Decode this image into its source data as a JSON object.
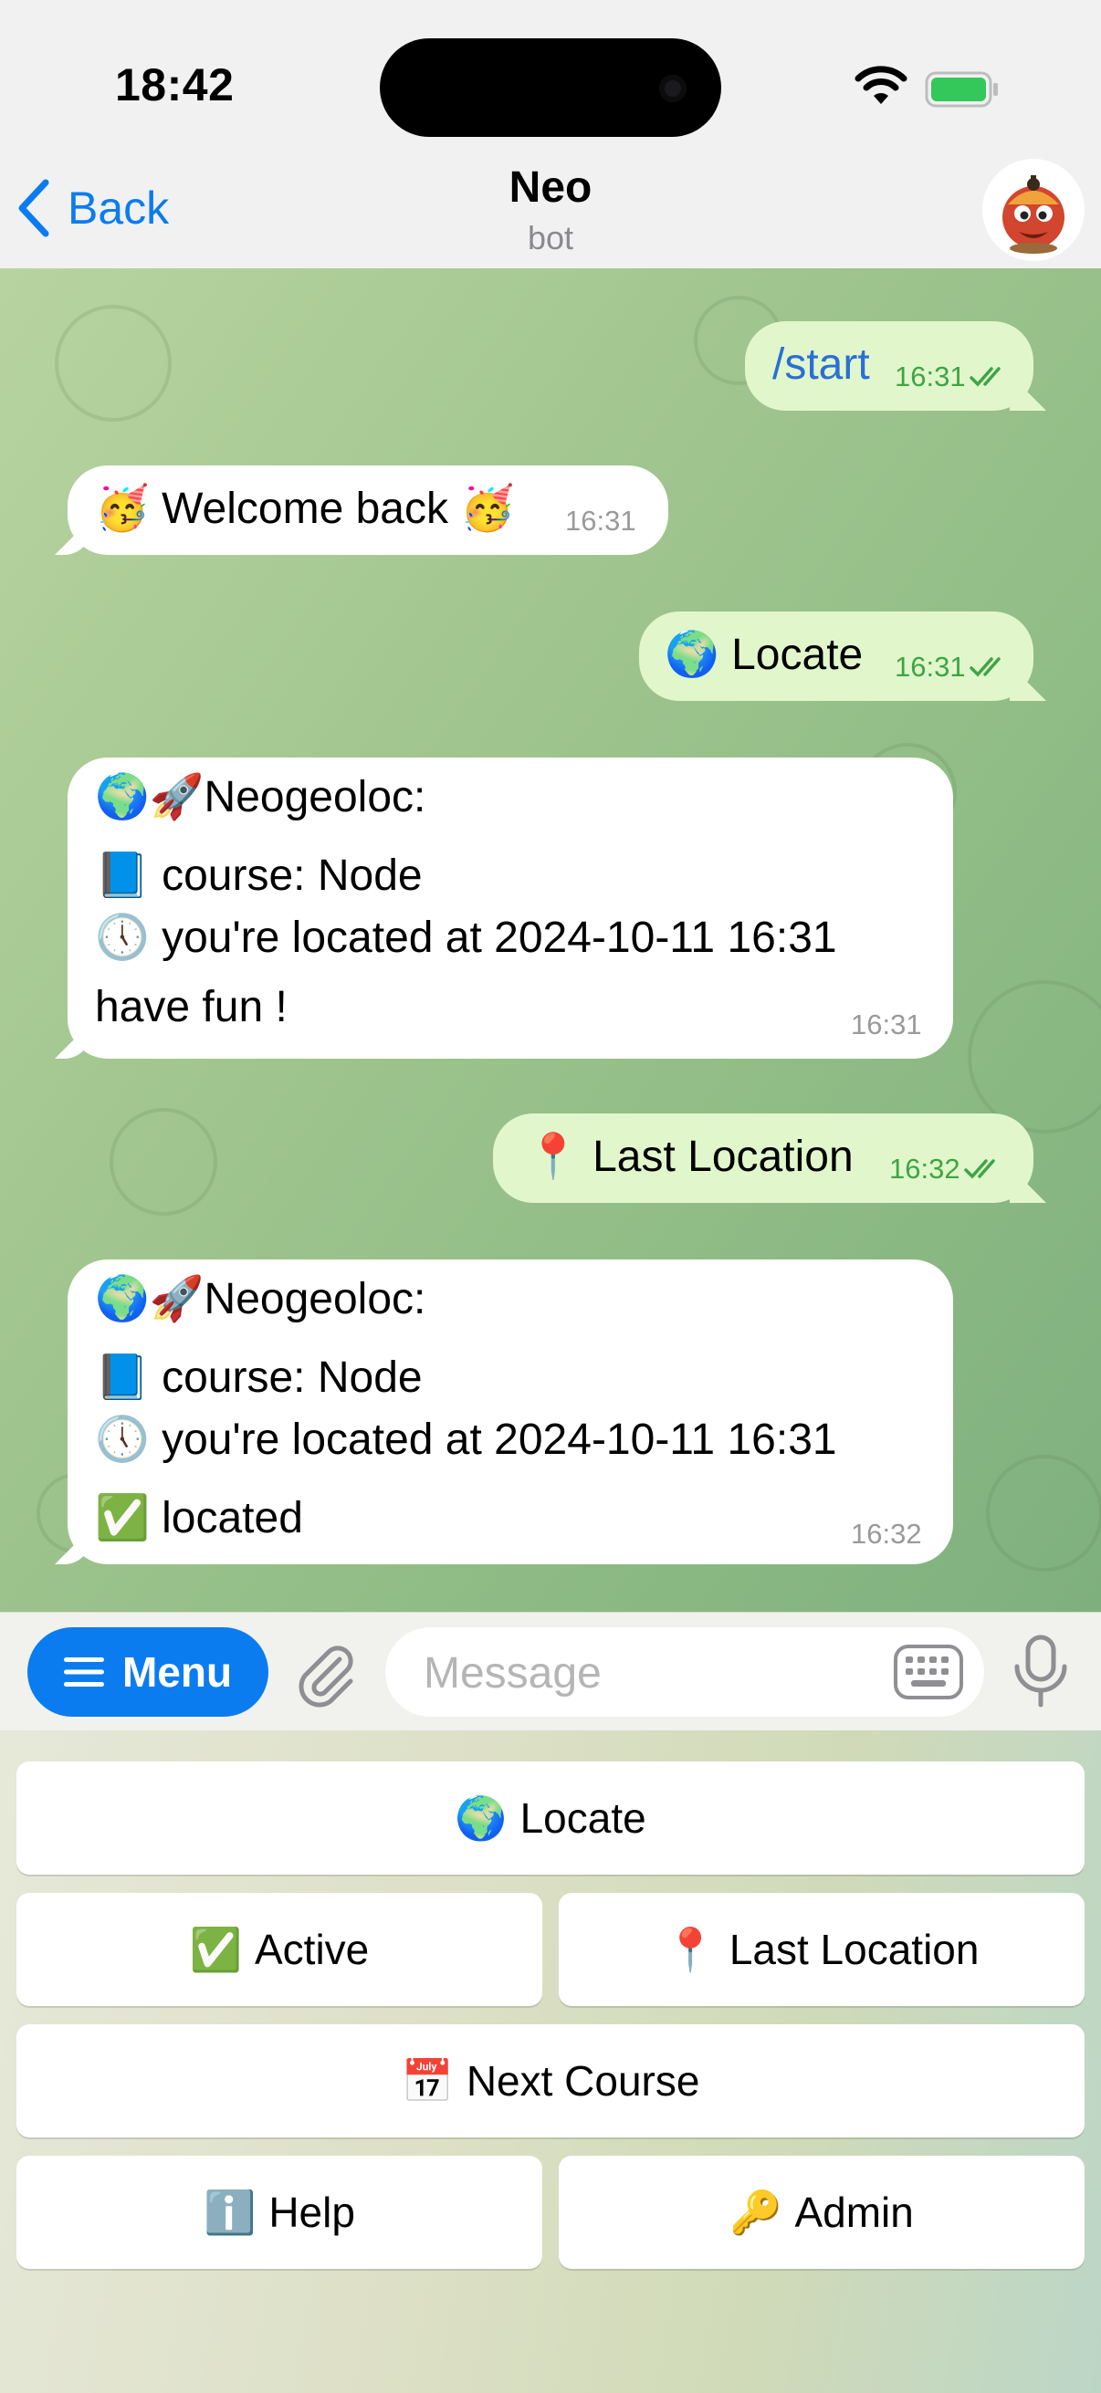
{
  "status_bar": {
    "time": "18:42"
  },
  "header": {
    "back_label": "Back",
    "title": "Neo",
    "subtitle": "bot"
  },
  "messages": [
    {
      "dir": "out",
      "text": "/start",
      "time": "16:31"
    },
    {
      "dir": "in",
      "text": "🥳 Welcome back 🥳",
      "time": "16:31"
    },
    {
      "dir": "out",
      "text": "🌍 Locate",
      "time": "16:31"
    },
    {
      "dir": "in",
      "lines": [
        "🌍🚀Neogeoloc:",
        "📘 course: Node",
        "🕔 you're located at 2024-10-11 16:31",
        "have fun !"
      ],
      "time": "16:31"
    },
    {
      "dir": "out",
      "text": "📍 Last Location",
      "time": "16:32"
    },
    {
      "dir": "in",
      "lines": [
        "🌍🚀Neogeoloc:",
        "📘 course: Node",
        "🕔 you're located at 2024-10-11 16:31",
        "✅ located"
      ],
      "time": "16:32"
    }
  ],
  "input": {
    "menu_label": "Menu",
    "placeholder": "Message"
  },
  "keyboard": {
    "locate": {
      "emoji": "🌍",
      "label": "Locate"
    },
    "active": {
      "emoji": "✅",
      "label": "Active"
    },
    "last_location": {
      "emoji": "📍",
      "label": "Last Location"
    },
    "next_course": {
      "emoji": "📅",
      "label": "Next Course"
    },
    "help": {
      "emoji": "ℹ️",
      "label": "Help"
    },
    "admin": {
      "emoji": "🔑",
      "label": "Admin"
    }
  },
  "colors": {
    "accent": "#0a7cf0",
    "outgoing_bubble": "#e1f7cb",
    "read_ticks": "#3da544"
  }
}
